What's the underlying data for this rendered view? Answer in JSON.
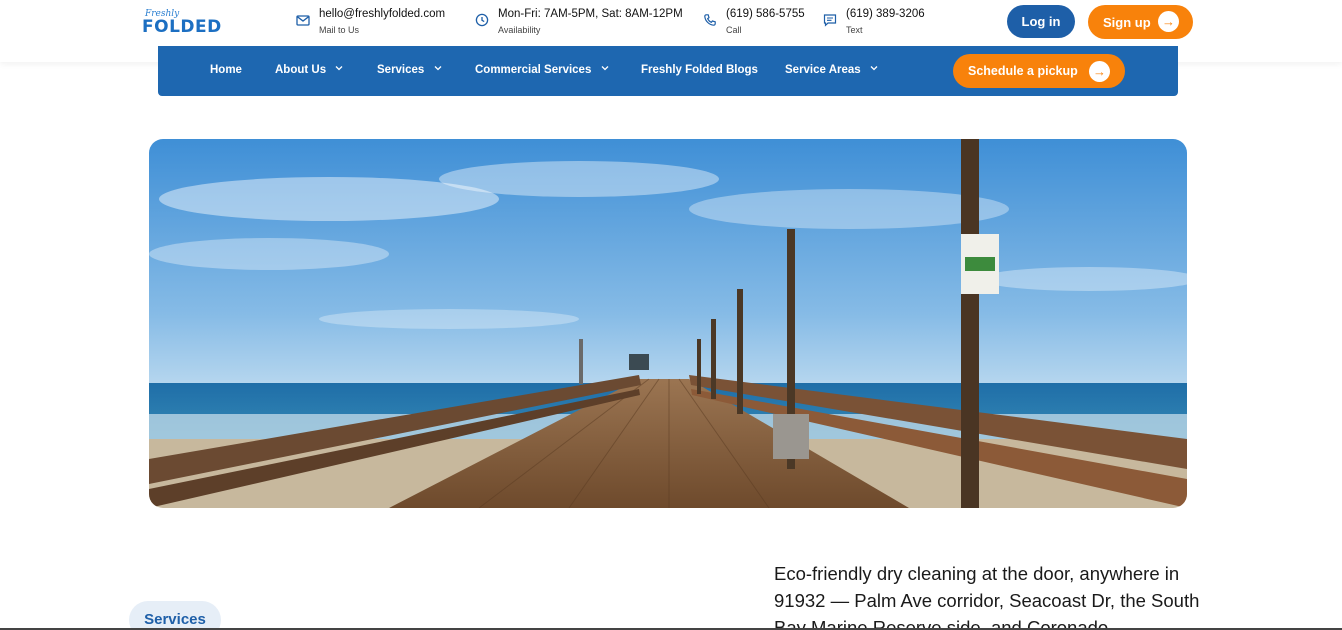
{
  "brand": {
    "script": "Freshly",
    "name": "FOLDED"
  },
  "header": {
    "contacts": [
      {
        "icon": "mail-icon",
        "main": "hello@freshlyfolded.com",
        "sub": "Mail to Us"
      },
      {
        "icon": "clock-icon",
        "main": "Mon-Fri: 7AM-5PM, Sat: 8AM-12PM",
        "sub": "Availability"
      },
      {
        "icon": "phone-icon",
        "main": "(619) 586-5755",
        "sub": "Call"
      },
      {
        "icon": "message-icon",
        "main": "(619) 389-3206",
        "sub": "Text"
      }
    ],
    "login_label": "Log in",
    "signup_label": "Sign up"
  },
  "nav": {
    "items": [
      {
        "label": "Home",
        "dropdown": false
      },
      {
        "label": "About Us",
        "dropdown": true
      },
      {
        "label": "Services",
        "dropdown": true
      },
      {
        "label": "Commercial Services",
        "dropdown": true
      },
      {
        "label": "Freshly Folded Blogs",
        "dropdown": false
      },
      {
        "label": "Service Areas",
        "dropdown": true
      }
    ],
    "cta_label": "Schedule a pickup"
  },
  "hero": {
    "icon": "pier-photo"
  },
  "content": {
    "tag": "Services",
    "intro": "Eco-friendly dry cleaning at the door, anywhere in 91932 — Palm Ave corridor, Seacoast Dr, the South Bay Marine Reserve side, and Coronado"
  },
  "colors": {
    "primary": "#1e67b0",
    "accent": "#f8820b",
    "pill_bg": "#e6eef7"
  }
}
